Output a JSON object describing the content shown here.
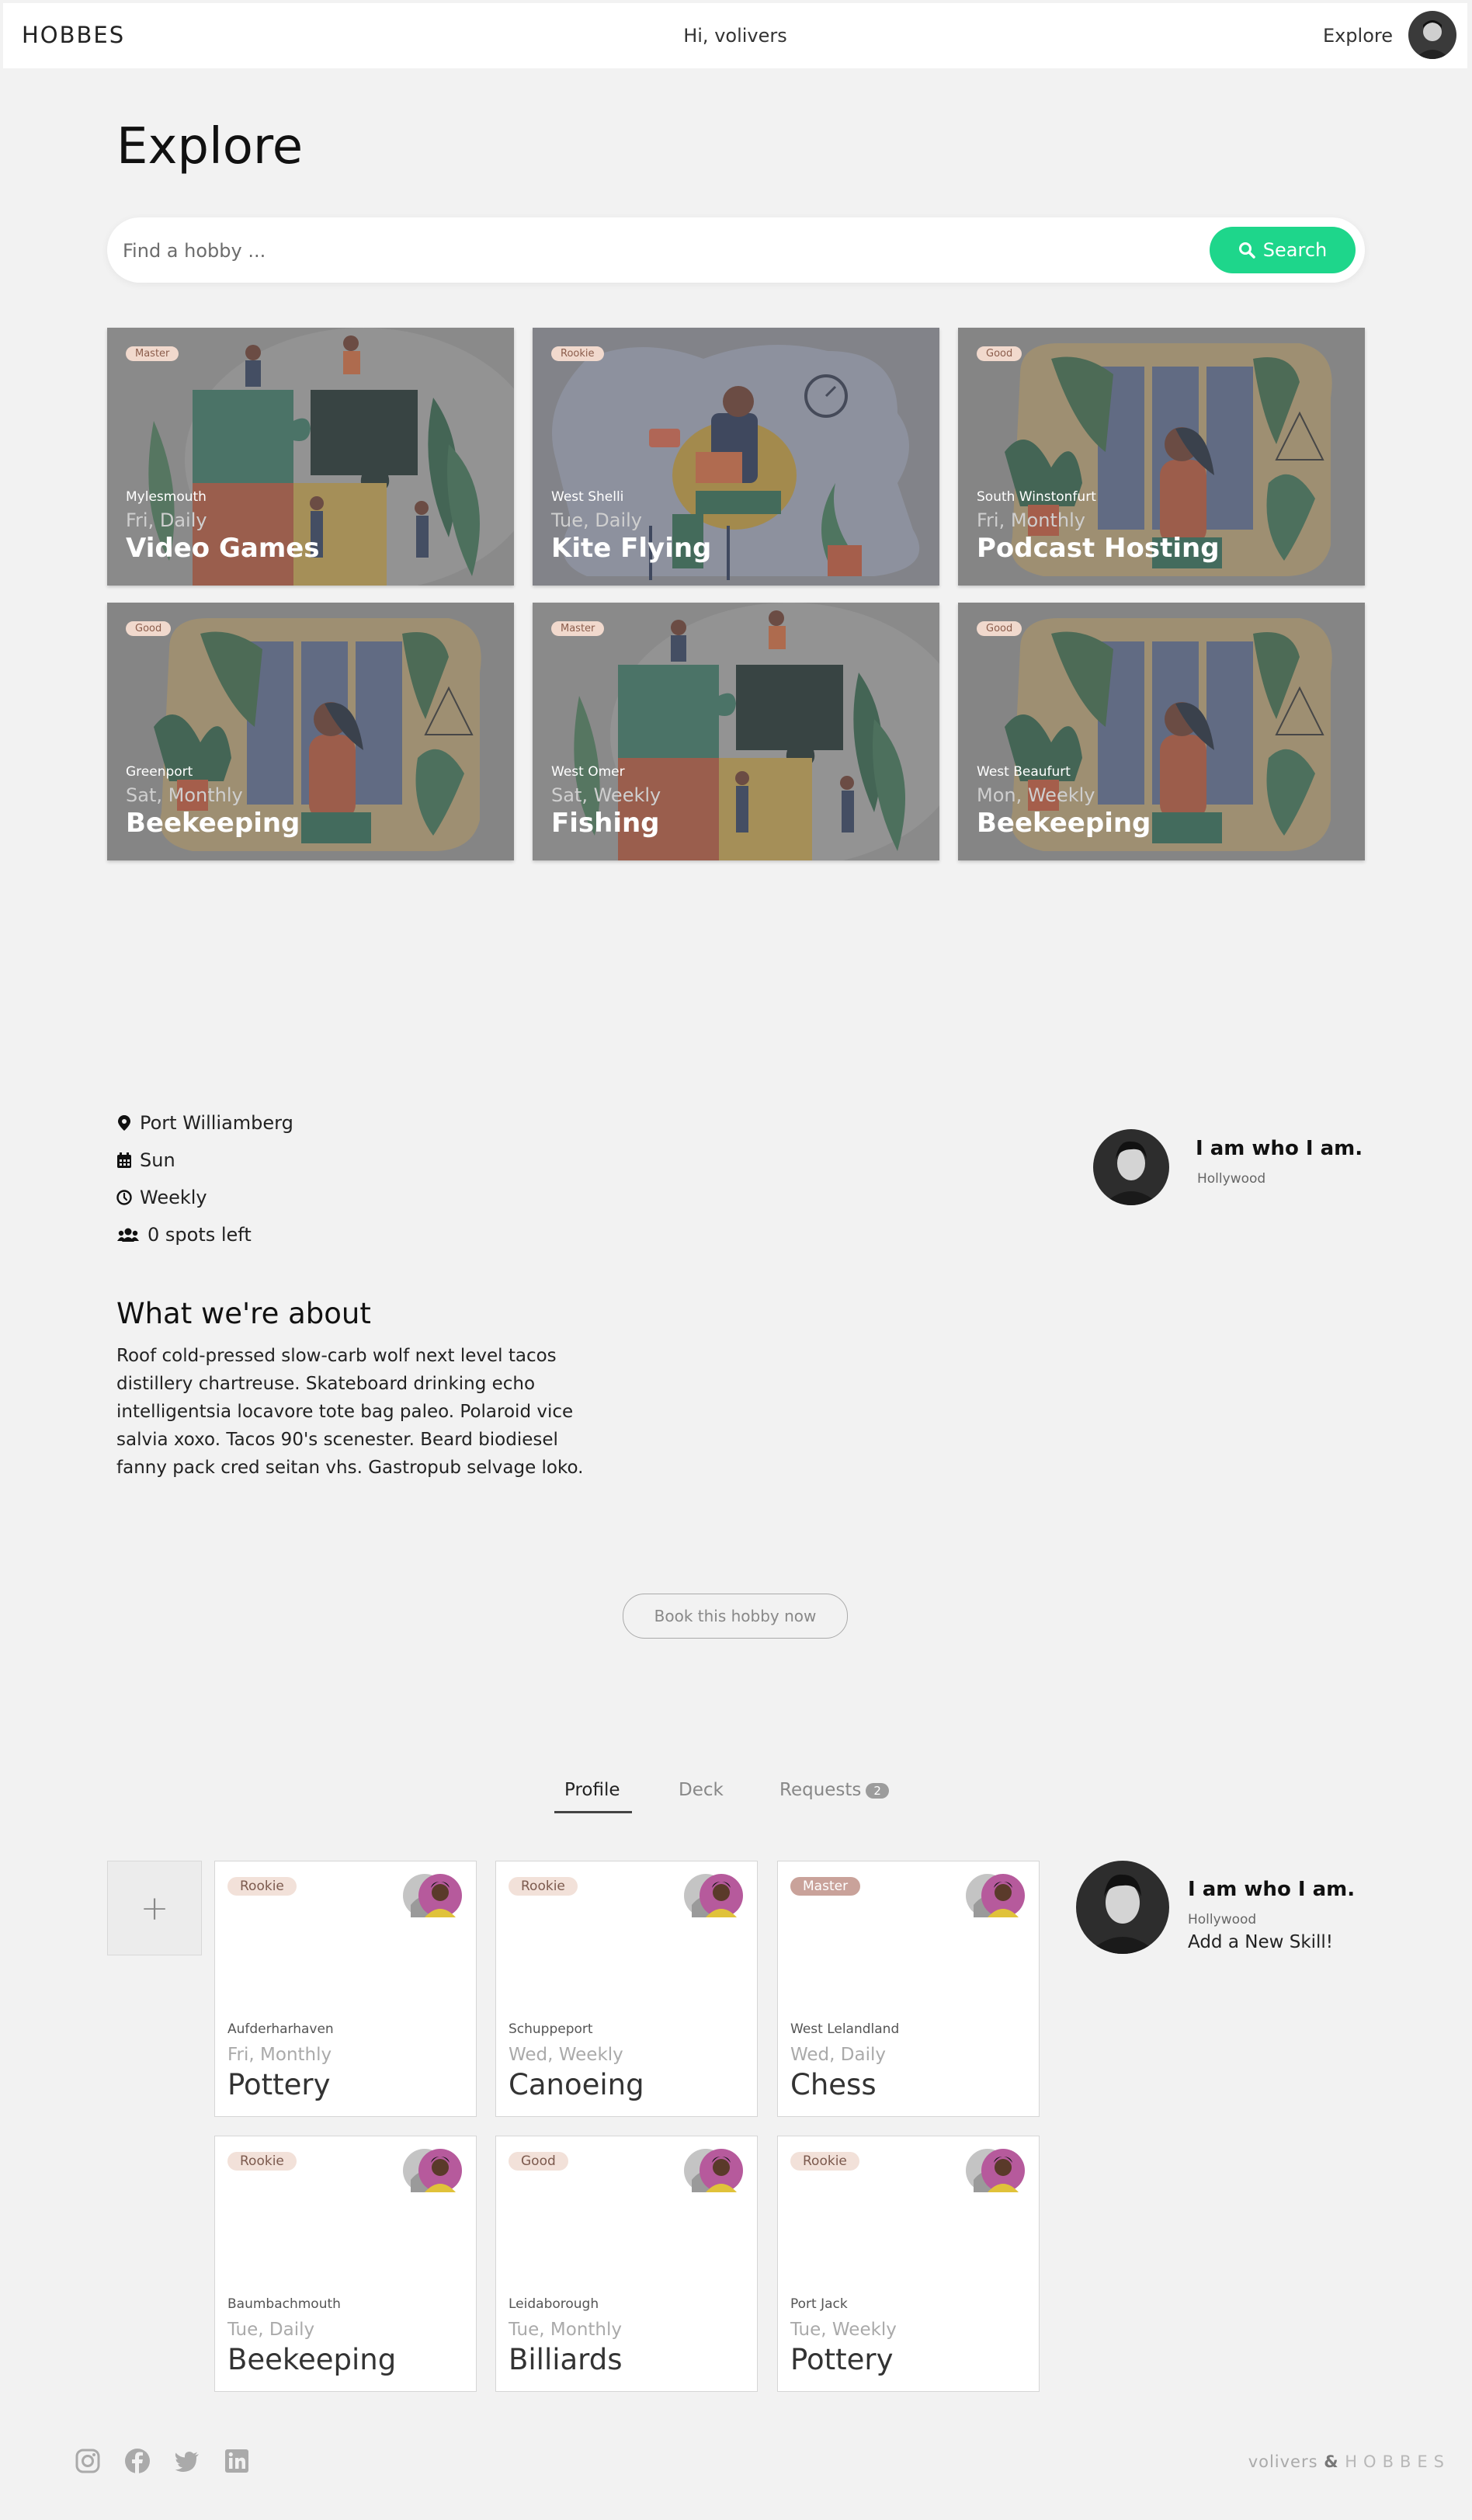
{
  "header": {
    "brand": "HOBBES",
    "greeting": "Hi, volivers",
    "nav_explore": "Explore"
  },
  "explore": {
    "title": "Explore",
    "search_placeholder": "Find a hobby ...",
    "search_button": "Search",
    "cards": [
      {
        "badge": "Master",
        "location": "Mylesmouth",
        "when": "Fri, Daily",
        "name": "Video Games",
        "illustration": "puzzle"
      },
      {
        "badge": "Rookie",
        "location": "West Shelli",
        "when": "Tue, Daily",
        "name": "Kite Flying",
        "illustration": "laptop"
      },
      {
        "badge": "Good",
        "location": "South Winstonfurt",
        "when": "Fri, Monthly",
        "name": "Podcast Hosting",
        "illustration": "window"
      },
      {
        "badge": "Good",
        "location": "Greenport",
        "when": "Sat, Monthly",
        "name": "Beekeeping",
        "illustration": "window"
      },
      {
        "badge": "Master",
        "location": "West Omer",
        "when": "Sat, Weekly",
        "name": "Fishing",
        "illustration": "puzzle"
      },
      {
        "badge": "Good",
        "location": "West Beaufurt",
        "when": "Mon, Weekly",
        "name": "Beekeeping",
        "illustration": "window"
      }
    ]
  },
  "detail": {
    "location": "Port Williamberg",
    "day": "Sun",
    "frequency": "Weekly",
    "spots": "0 spots left",
    "about_title": "What we're about",
    "about_text": "Roof cold-pressed slow-carb wolf next level tacos distillery chartreuse. Skateboard drinking echo intelligentsia locavore tote bag paleo. Polaroid vice salvia xoxo. Tacos 90's scenester. Beard biodiesel fanny pack cred seitan vhs. Gastropub selvage loko.",
    "owner_name": "I am who I am.",
    "owner_location": "Hollywood",
    "book_button": "Book this hobby now"
  },
  "profile": {
    "tabs": [
      {
        "label": "Profile",
        "active": true
      },
      {
        "label": "Deck",
        "active": false
      },
      {
        "label": "Requests",
        "active": false,
        "count": "2"
      }
    ],
    "add_label": "+",
    "cards": [
      {
        "badge": "Rookie",
        "location": "Aufderharhaven",
        "when": "Fri, Monthly",
        "name": "Pottery"
      },
      {
        "badge": "Rookie",
        "location": "Schuppeport",
        "when": "Wed, Weekly",
        "name": "Canoeing"
      },
      {
        "badge": "Master",
        "location": "West Lelandland",
        "when": "Wed, Daily",
        "name": "Chess"
      },
      {
        "badge": "Rookie",
        "location": "Baumbachmouth",
        "when": "Tue, Daily",
        "name": "Beekeeping"
      },
      {
        "badge": "Good",
        "location": "Leidaborough",
        "when": "Tue, Monthly",
        "name": "Billiards"
      },
      {
        "badge": "Rookie",
        "location": "Port Jack",
        "when": "Tue, Weekly",
        "name": "Pottery"
      }
    ],
    "side_user": "I am who I am.",
    "side_location": "Hollywood",
    "side_action": "Add a New Skill!"
  },
  "footer": {
    "user": "volivers",
    "amp": "&",
    "brand": "HOBBES",
    "social_icons": [
      "instagram-icon",
      "facebook-icon",
      "twitter-icon",
      "linkedin-icon"
    ]
  }
}
